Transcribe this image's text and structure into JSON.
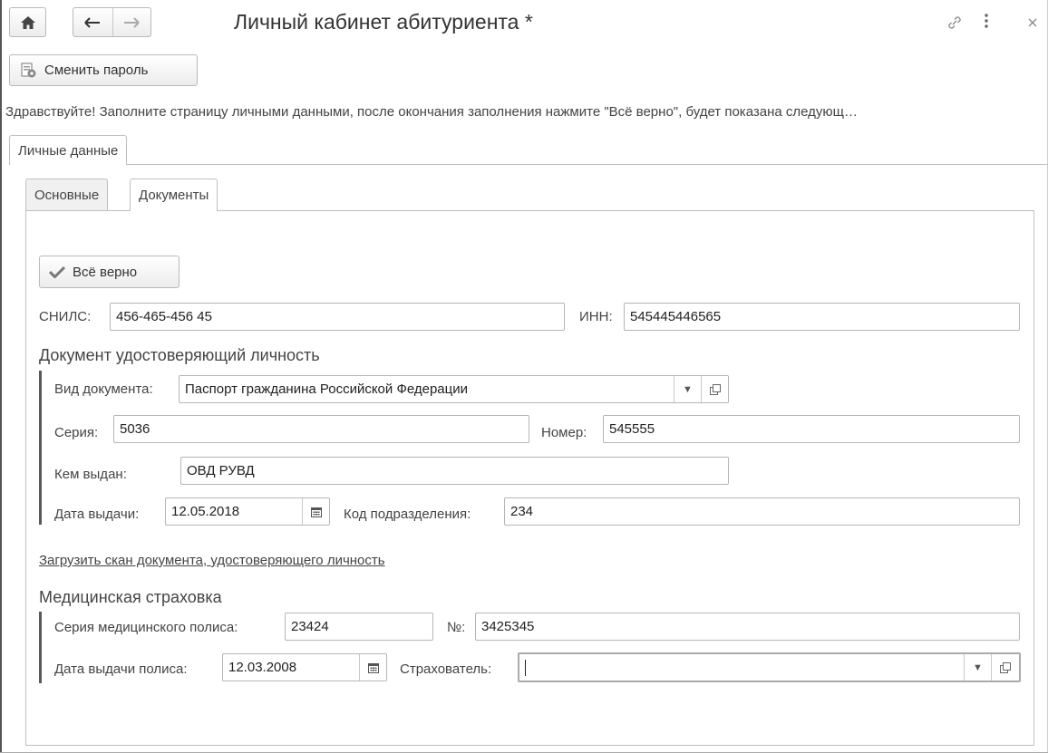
{
  "window": {
    "title": "Личный кабинет абитуриента *"
  },
  "toolbar": {
    "change_password": "Сменить пароль"
  },
  "info_message": "Здравствуйте! Заполните страницу личными данными, после окончания заполнения нажмите \"Всё верно\", будет показана следующ…",
  "tabs_outer": [
    {
      "label": "Личные данные",
      "active": true
    }
  ],
  "tabs_inner": [
    {
      "label": "Основные",
      "active": false
    },
    {
      "label": "Документы",
      "active": true
    }
  ],
  "confirm_button": "Всё верно",
  "snils": {
    "label": "СНИЛС:",
    "value": "456-465-456 45"
  },
  "inn": {
    "label": "ИНН:",
    "value": "545445446565"
  },
  "identity_doc": {
    "title": "Документ удостоверяющий личность",
    "doc_type": {
      "label": "Вид документа:",
      "value": "Паспорт гражданина Российской Федерации"
    },
    "series": {
      "label": "Серия:",
      "value": "5036"
    },
    "number": {
      "label": "Номер:",
      "value": "545555"
    },
    "issued_by": {
      "label": "Кем выдан:",
      "value": "ОВД РУВД"
    },
    "issue_date": {
      "label": "Дата выдачи:",
      "value": "12.05.2018"
    },
    "department_code": {
      "label": "Код подразделения:",
      "value": "234"
    }
  },
  "upload_scan_link": "Загрузить скан документа, удостоверяющего личность",
  "insurance": {
    "title": "Медицинская страховка",
    "policy_series": {
      "label": "Серия медицинского полиса:",
      "value": "23424"
    },
    "policy_number": {
      "label": "№:",
      "value": "3425345"
    },
    "policy_date": {
      "label": "Дата выдачи полиса:",
      "value": "12.03.2008"
    },
    "insurer": {
      "label": "Страхователь:",
      "value": ""
    }
  },
  "icons": {
    "home": "home-icon",
    "back": "arrow-left-icon",
    "forward": "arrow-right-icon",
    "link": "link-icon",
    "more": "more-vertical-icon",
    "close": "close-icon",
    "calendar": "calendar-icon",
    "dropdown": "chevron-down-icon",
    "open": "open-form-icon",
    "check": "checkmark-icon"
  }
}
